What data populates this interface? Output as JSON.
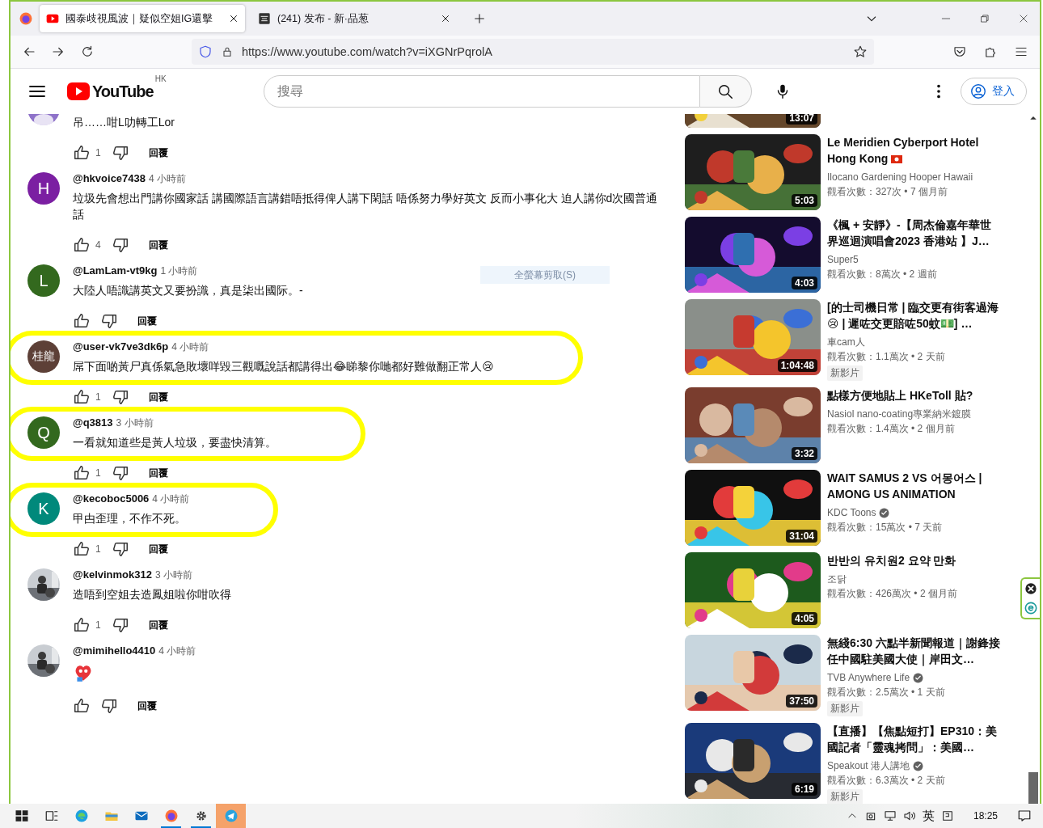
{
  "browser": {
    "tabs": [
      {
        "title": "國泰歧視風波｜疑似空姐IG還擊",
        "selected": true
      },
      {
        "title": "(241) 发布 - 新·品葱",
        "selected": false
      }
    ],
    "url": "https://www.youtube.com/watch?v=iXGNrPqrolA"
  },
  "masthead": {
    "logo": "YouTube",
    "region": "HK",
    "search_placeholder": "搜尋",
    "sign_in": "登入"
  },
  "comments": [
    {
      "avatar": {
        "kind": "silhouette",
        "color": "#8e72c9"
      },
      "text": "吊……咁L叻轉工Lor",
      "likes": "1",
      "reply": "回覆",
      "highlighted": false
    },
    {
      "author": "@hkvoice7438",
      "time": "4 小時前",
      "avatar": {
        "kind": "letter",
        "letter": "H",
        "color": "#7b1fa2"
      },
      "text": "垃圾先會想出門講你國家話 講國際語言講錯唔抵得俾人講下閑話 唔係努力學好英文 反而小事化大 迫人講你d次國普通話",
      "likes": "4",
      "reply": "回覆",
      "highlighted": false
    },
    {
      "author": "@LamLam-vt9kg",
      "time": "1 小時前",
      "avatar": {
        "kind": "letter",
        "letter": "L",
        "color": "#33691e"
      },
      "text": "大陸人唔識講英文又要扮識，真是柒出國际。-",
      "reply": "回覆",
      "highlighted": false
    },
    {
      "author": "@user-vk7ve3dk6p",
      "time": "4 小時前",
      "avatar": {
        "kind": "letter",
        "letter": "桂龍",
        "color": "#5d4037"
      },
      "text": "屌下面啲黃尸真係氣急敗壞咩毀三觀嘅說話都講得出😂睇黎你哋都好難做翻正常人😢",
      "likes": "1",
      "reply": "回覆",
      "highlighted": true
    },
    {
      "author": "@q3813",
      "time": "3 小時前",
      "avatar": {
        "kind": "letter",
        "letter": "Q",
        "color": "#33691e"
      },
      "text": "一看就知道些是黃人垃圾，要盡快清算。",
      "likes": "1",
      "reply": "回覆",
      "highlighted": true
    },
    {
      "author": "@kecoboc5006",
      "time": "4 小時前",
      "avatar": {
        "kind": "letter",
        "letter": "K",
        "color": "#00897b"
      },
      "text": "甲甴歪理，不作不死。",
      "likes": "1",
      "reply": "回覆",
      "highlighted": true
    },
    {
      "author": "@kelvinmok312",
      "time": "3 小時前",
      "text": "造唔到空姐去造鳳姐啦你咁吹得",
      "likes": "1",
      "reply": "回覆",
      "highlighted": false
    },
    {
      "author": "@mimihello4410",
      "time": "4 小時前",
      "sticker": true,
      "reply": "回覆",
      "highlighted": false
    }
  ],
  "tooltip": "全螢幕剪取(S)",
  "videos": [
    {
      "partial": true,
      "duration": "13:07"
    },
    {
      "title": "Le Meridien Cyberport Hotel Hong Kong",
      "flag": true,
      "channel": "Ilocano Gardening Hooper Hawaii",
      "verified": false,
      "meta": "觀看次數：327次 • 7 個月前",
      "duration": "5:03"
    },
    {
      "title": "《楓 + 安靜》-【周杰倫嘉年華世界巡迴演唱會2023 香港站 】J…",
      "channel": "Super5",
      "verified": false,
      "meta": "觀看次數：8萬次 • 2 週前",
      "duration": "4:03"
    },
    {
      "title": "[的士司機日常 | 臨交更有街客過海😢 | 遲咗交更賠咗50蚊💵] …",
      "channel": "車cam人",
      "verified": false,
      "meta": "觀看次數：1.1萬次 • 2 天前",
      "badge": "新影片",
      "duration": "1:04:48"
    },
    {
      "title": "點樣方便地貼上 HKeToll 貼?",
      "channel": "Nasiol nano-coating專業納米鍍膜",
      "verified": false,
      "meta": "觀看次數：1.4萬次 • 2 個月前",
      "duration": "3:32"
    },
    {
      "title": "WAIT SAMUS 2 VS 어몽어스 | AMONG US ANIMATION",
      "channel": "KDC Toons",
      "verified": true,
      "meta": "觀看次數：15萬次 • 7 天前",
      "duration": "31:04"
    },
    {
      "title": "반반의 유치원2 요약 만화",
      "channel": "조닭",
      "verified": false,
      "meta": "觀看次數：426萬次 • 2 個月前",
      "duration": "4:05"
    },
    {
      "title": "無綫6:30 六點半新聞報道｜謝鋒接任中國駐美國大使｜岸田文…",
      "channel": "TVB Anywhere Life",
      "verified": true,
      "meta": "觀看次數：2.5萬次 • 1 天前",
      "badge": "新影片",
      "duration": "37:50"
    },
    {
      "title": "【直播】【焦點短打】EP310：美國記者「靈魂拷問」：美國…",
      "channel": "Speakout 港人講地",
      "verified": true,
      "meta": "觀看次數：6.3萬次 • 2 天前",
      "badge": "新影片",
      "duration": "6:19"
    }
  ],
  "taskbar": {
    "apps": [
      {
        "running": false,
        "selected": false
      },
      {
        "running": false,
        "selected": false
      },
      {
        "running": false,
        "selected": false
      },
      {
        "running": false,
        "selected": false
      },
      {
        "running": false,
        "selected": false
      },
      {
        "running": true,
        "selected": false
      },
      {
        "running": true,
        "selected": false
      },
      {
        "running": false,
        "selected": true
      }
    ],
    "ime": "英",
    "time": "18:25"
  }
}
